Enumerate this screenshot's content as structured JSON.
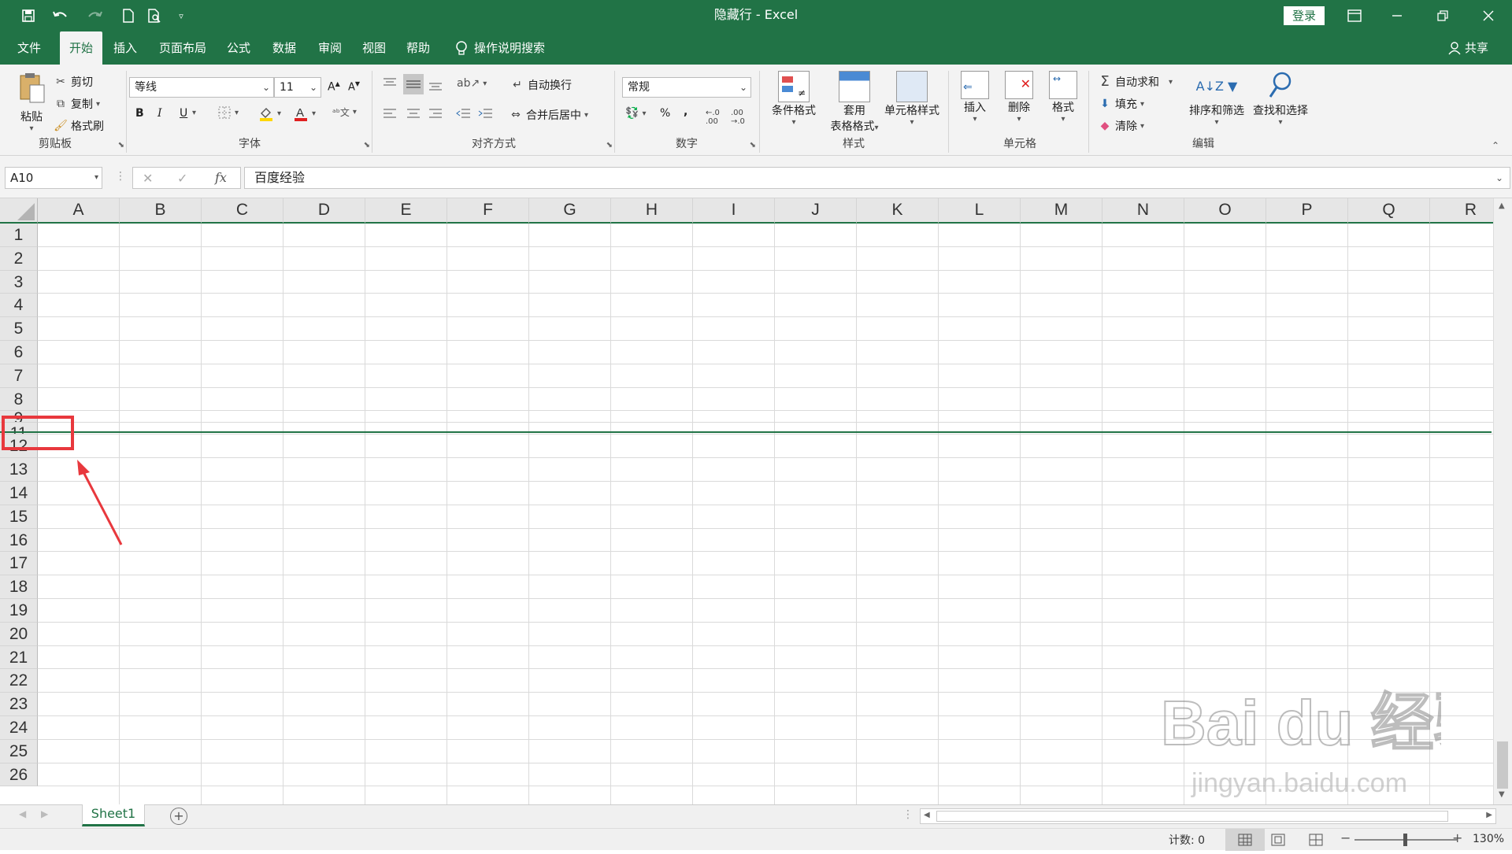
{
  "window": {
    "title": "隐藏行 - Excel",
    "login_label": "登录",
    "share_label": "共享"
  },
  "tabs": [
    "文件",
    "开始",
    "插入",
    "页面布局",
    "公式",
    "数据",
    "审阅",
    "视图",
    "帮助"
  ],
  "tell_me": "操作说明搜索",
  "ribbon": {
    "clipboard": {
      "label": "剪贴板",
      "paste": "粘贴",
      "cut": "剪切",
      "copy": "复制",
      "format_painter": "格式刷"
    },
    "font": {
      "label": "字体",
      "font_name": "等线",
      "font_size": "11",
      "bold": "B",
      "italic": "I",
      "underline": "U"
    },
    "alignment": {
      "label": "对齐方式",
      "wrap_text": "自动换行",
      "merge_center": "合并后居中"
    },
    "number": {
      "label": "数字",
      "format": "常规",
      "percent": "%",
      "comma": ","
    },
    "styles": {
      "label": "样式",
      "conditional": "条件格式",
      "table_format_1": "套用",
      "table_format_2": "表格格式",
      "cell_styles": "单元格样式"
    },
    "cells": {
      "label": "单元格",
      "insert": "插入",
      "delete": "删除",
      "format": "格式"
    },
    "editing": {
      "label": "编辑",
      "autosum": "自动求和",
      "fill": "填充",
      "clear": "清除",
      "sort_filter": "排序和筛选",
      "find_select": "查找和选择"
    }
  },
  "formula_bar": {
    "name_box": "A10",
    "fx": "fx",
    "value": "百度经验"
  },
  "columns": [
    "A",
    "B",
    "C",
    "D",
    "E",
    "F",
    "G",
    "H",
    "I",
    "J",
    "K",
    "L",
    "M",
    "N",
    "O",
    "P",
    "Q",
    "R"
  ],
  "rows": [
    "1",
    "2",
    "3",
    "4",
    "5",
    "6",
    "7",
    "8",
    "9",
    "11",
    "12",
    "13",
    "14",
    "15",
    "16",
    "17",
    "18",
    "19",
    "20",
    "21",
    "22",
    "23",
    "24",
    "25",
    "26"
  ],
  "sheets": [
    "Sheet1"
  ],
  "status": {
    "count_label": "计数: 0",
    "zoom": "130%"
  },
  "watermark": {
    "text": "Bai du 经验",
    "url": "jingyan.baidu.com"
  },
  "colors": {
    "accent": "#217346",
    "annotation": "#e8383d"
  }
}
